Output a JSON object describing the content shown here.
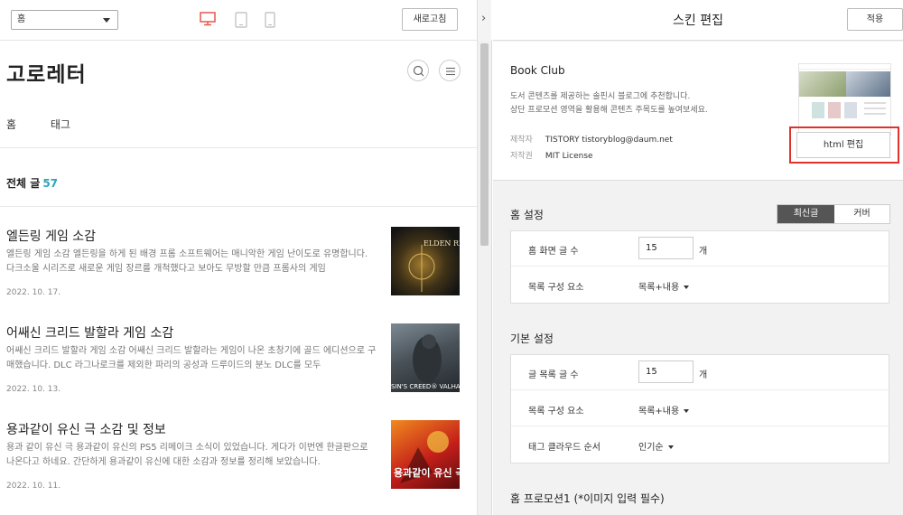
{
  "toolbar": {
    "page_select": "홈",
    "devices": [
      "desktop-icon",
      "tablet-icon",
      "mobile-icon"
    ],
    "refresh_label": "새로고침",
    "collapse_icon": "›"
  },
  "blog": {
    "title": "고로레터",
    "nav": [
      "홈",
      "태그"
    ],
    "total_label": "전체 글",
    "total_count": "57",
    "posts": [
      {
        "title": "엘든링 게임 소감",
        "excerpt": "엘든링 게임 소감 엘든링을 하게 된 배경 프롬 소프트웨어는 매니악한 게임 난이도로 유명합니다. 다크소울 시리즈로 새로운 게임 장르를 개척했다고 보아도 무방할 만큼 프롬사의 게임",
        "date": "2022. 10. 17.",
        "thumb_text": "ELDEN RI"
      },
      {
        "title": "어쌔신 크리드 발할라 게임 소감",
        "excerpt": "어쌔신 크리드 발할라 게임 소감 어쌔신 크리드 발할라는 게임이 나온 초창기에 골드 에디션으로 구매했습니다. DLC 라그나로크를 제외한 파리의 공성과 드루이드의 분노 DLC를 모두",
        "date": "2022. 10. 13.",
        "thumb_text": "SIN'S CREED® VALHA"
      },
      {
        "title": "용과같이 유신 극 소감 및 정보",
        "excerpt": "용과 같이 유신 극 용과같이 유신의 PS5 리메이크 소식이 있었습니다. 게다가 이번엔 한글판으로 나온다고 하네요. 간단하게 용과같이 유신에 대한 소감과 정보를 정리해 보았습니다.",
        "date": "2022. 10. 11.",
        "thumb_text": "용과같이 유신 극"
      }
    ]
  },
  "skin": {
    "header_title": "스킨 편집",
    "apply_label": "적용",
    "name": "Book Club",
    "desc_line1": "도서 콘텐츠를 제공하는 솔핀시 블로그에 추천합니다.",
    "desc_line2": "상단 프로모션 영역을 활용해 콘텐츠 주목도를 높여보세요.",
    "author_label": "제작자",
    "author_value": "TISTORY tistoryblog@daum.net",
    "license_label": "저작권",
    "license_value": "MIT License",
    "html_edit_label": "html 편집"
  },
  "home_settings": {
    "title": "홈 설정",
    "toggle_on": "최신글",
    "toggle_off": "커버",
    "rows": [
      {
        "label": "홈 화면 글 수",
        "value": "15",
        "unit": "개"
      },
      {
        "label": "목록 구성 요소",
        "select": "목록+내용"
      }
    ]
  },
  "basic_settings": {
    "title": "기본 설정",
    "rows": [
      {
        "label": "글 목록 글 수",
        "value": "15",
        "unit": "개"
      },
      {
        "label": "목록 구성 요소",
        "select": "목록+내용"
      },
      {
        "label": "태그 클라우드 순서",
        "select": "인기순"
      }
    ]
  },
  "promo": {
    "title": "홈 프로모션1 (*이미지 입력 필수)"
  },
  "colors": {
    "accent_count": "#2aa6b8",
    "highlight": "#e0312b",
    "device_active": "#e8564b",
    "toggle_active_bg": "#555555"
  }
}
